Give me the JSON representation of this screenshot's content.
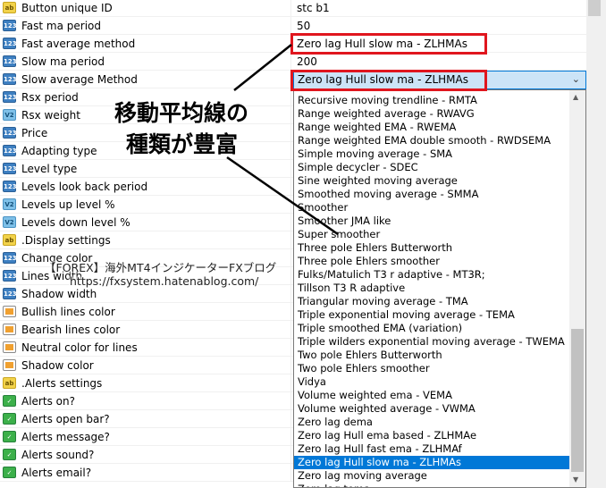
{
  "properties": [
    {
      "icon": "ab",
      "label": "Button unique ID",
      "value": "stc b1"
    },
    {
      "icon": "123",
      "label": "Fast ma period",
      "value": "50"
    },
    {
      "icon": "123",
      "label": "Fast average method",
      "value": "Zero lag Hull slow ma - ZLHMAs"
    },
    {
      "icon": "123",
      "label": "Slow ma period",
      "value": "200"
    },
    {
      "icon": "123",
      "label": "Slow average Method",
      "value": ""
    },
    {
      "icon": "123",
      "label": "Rsx period",
      "value": ""
    },
    {
      "icon": "v2",
      "label": "Rsx weight",
      "value": ""
    },
    {
      "icon": "123",
      "label": "Price",
      "value": ""
    },
    {
      "icon": "123",
      "label": "Adapting type",
      "value": ""
    },
    {
      "icon": "123",
      "label": "Level type",
      "value": ""
    },
    {
      "icon": "123",
      "label": "Levels look back period",
      "value": ""
    },
    {
      "icon": "v2",
      "label": "Levels up level %",
      "value": ""
    },
    {
      "icon": "v2",
      "label": "Levels down level %",
      "value": ""
    },
    {
      "icon": "ab",
      "label": ".Display settings",
      "value": ""
    },
    {
      "icon": "123",
      "label": "Change color",
      "value": ""
    },
    {
      "icon": "123",
      "label": "Lines width",
      "value": ""
    },
    {
      "icon": "123",
      "label": "Shadow width",
      "value": ""
    },
    {
      "icon": "color",
      "label": "Bullish lines color",
      "value": ""
    },
    {
      "icon": "color",
      "label": "Bearish lines color",
      "value": ""
    },
    {
      "icon": "color",
      "label": "Neutral color for lines",
      "value": ""
    },
    {
      "icon": "color",
      "label": "Shadow color",
      "value": ""
    },
    {
      "icon": "ab",
      "label": ".Alerts settings",
      "value": ""
    },
    {
      "icon": "bool",
      "label": "Alerts on?",
      "value": ""
    },
    {
      "icon": "bool",
      "label": "Alerts open bar?",
      "value": ""
    },
    {
      "icon": "bool",
      "label": "Alerts message?",
      "value": ""
    },
    {
      "icon": "bool",
      "label": "Alerts sound?",
      "value": ""
    },
    {
      "icon": "bool",
      "label": "Alerts email?",
      "value": ""
    }
  ],
  "dropdown": {
    "selected": "Zero lag Hull slow ma - ZLHMAs",
    "options": [
      "Recursive moving trendline - RMTA",
      "Range weighted average - RWAVG",
      "Range weighted EMA - RWEMA",
      "Range weighted EMA double smooth - RWDSEMA",
      "Simple moving average - SMA",
      "Simple decycler - SDEC",
      "Sine weighted moving average",
      "Smoothed moving average - SMMA",
      "Smoother",
      "Smoother JMA like",
      "Super smoother",
      "Three pole Ehlers Butterworth",
      "Three pole Ehlers smoother",
      "Fulks/Matulich T3 r adaptive - MT3R;",
      "Tillson T3 R adaptive",
      "Triangular moving average - TMA",
      "Triple exponential moving average - TEMA",
      "Triple smoothed EMA (variation)",
      "Triple wilders exponential moving average - TWEMA",
      "Two pole Ehlers Butterworth",
      "Two pole Ehlers smoother",
      "Vidya",
      "Volume weighted ema - VEMA",
      "Volume weighted average - VWMA",
      "Zero lag dema",
      "Zero lag Hull ema based - ZLHMAe",
      "Zero lag Hull fast ema - ZLHMAf",
      "Zero lag Hull slow ma - ZLHMAs",
      "Zero lag moving average",
      "Zero lag tema"
    ],
    "selected_index": 27,
    "chevron": "chevron-down-icon"
  },
  "annotation": {
    "line1": "移動平均線の",
    "line2": "種類が豊富",
    "highlight_color": "#e0161e"
  },
  "watermark": {
    "line1": "【FOREX】海外MT4インジケーターFXブログ",
    "line2": "https://fxsystem.hatenablog.com/"
  }
}
